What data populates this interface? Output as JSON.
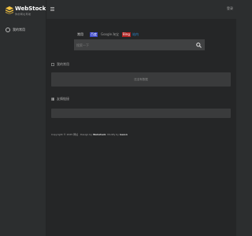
{
  "sidebar": {
    "logo_name": "WebStock",
    "logo_tag": "你的网址导航",
    "items": [
      {
        "label": "我的常用",
        "icon": "circle-icon"
      }
    ]
  },
  "topbar": {
    "menu_icon": "menu-icon",
    "login_label": "登录"
  },
  "search": {
    "tabs": [
      {
        "label": "常用",
        "active": true
      },
      {
        "label": "百度",
        "badge": true,
        "color": "#3a45c8"
      },
      {
        "label": "Google"
      },
      {
        "label": "淘宝"
      },
      {
        "label": "Bing",
        "badge": true,
        "color": "#b22222"
      },
      {
        "label": "站内",
        "color": "#2a8bd6"
      }
    ],
    "placeholder": "搜索一下",
    "button_icon": "search-icon"
  },
  "sections": {
    "favorites_title": "我的常用",
    "favorites_empty": "还没有数据",
    "links_title": "友情链接"
  },
  "footer": {
    "prefix": "Copyright © 2025 网址 · Design by ",
    "brand": "Webstack",
    "mid": ". Modify by ",
    "author": "iowen"
  }
}
